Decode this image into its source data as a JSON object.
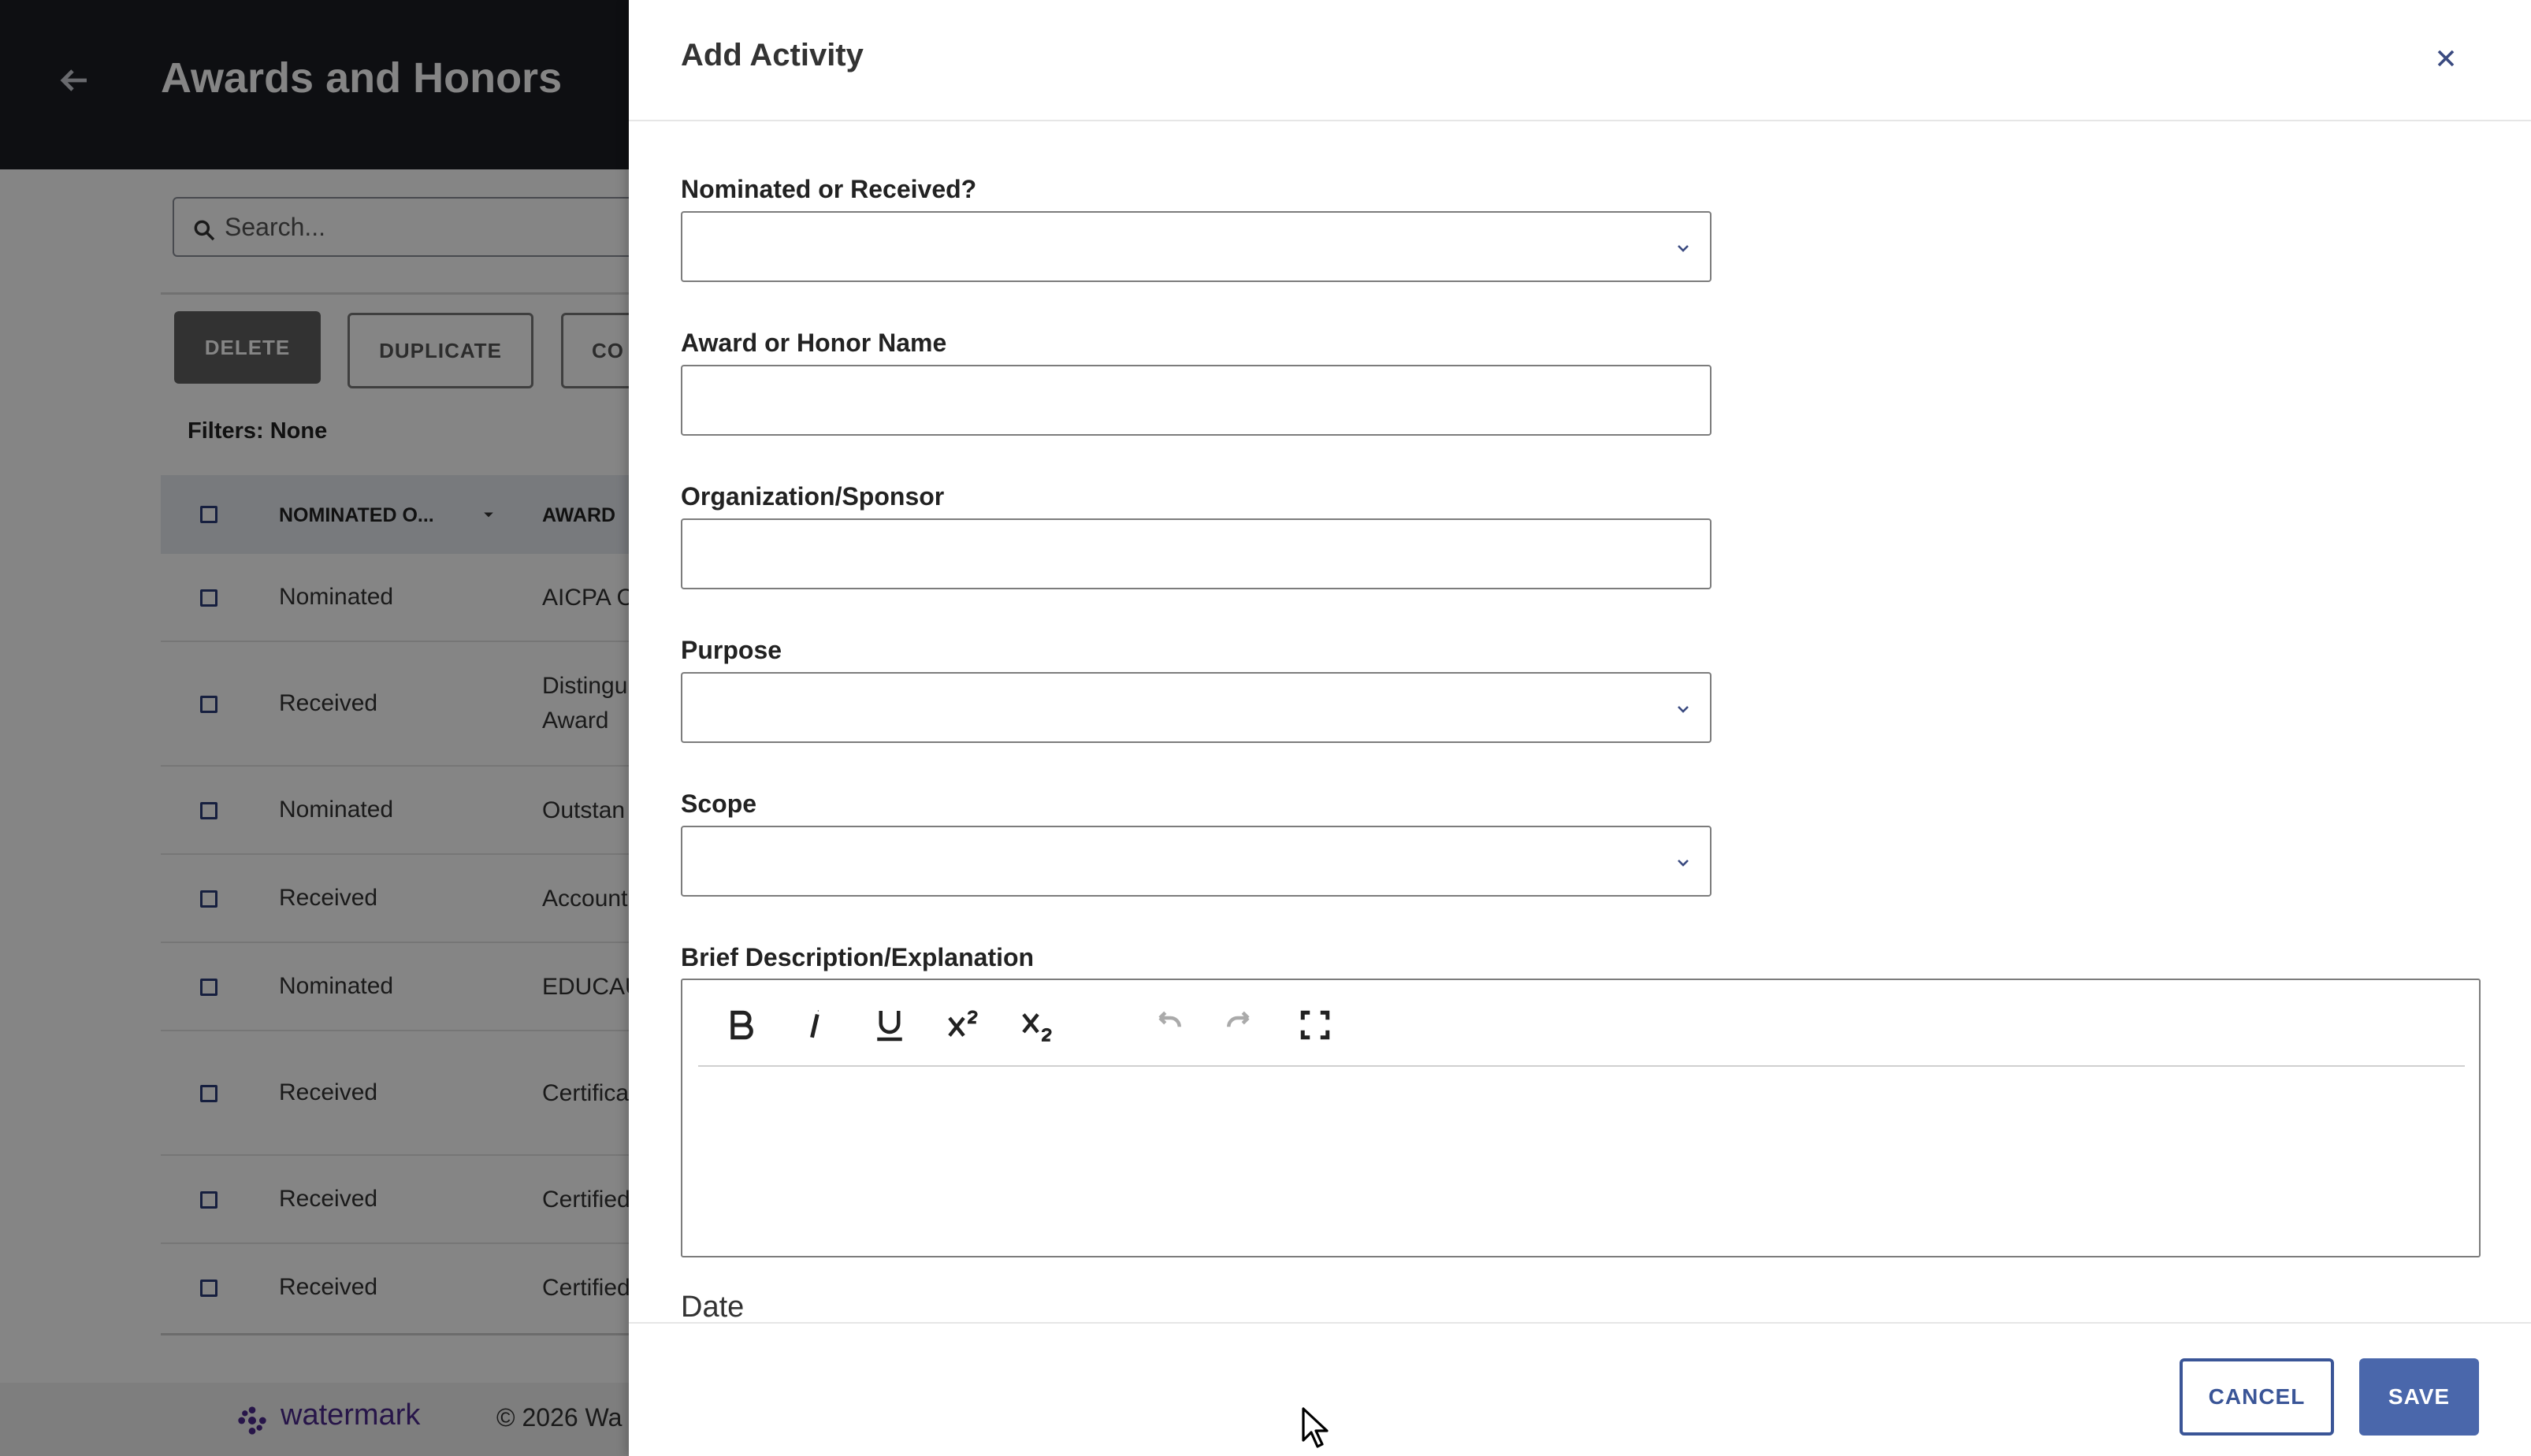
{
  "background": {
    "title": "Awards and Honors",
    "search_placeholder": "Search...",
    "buttons": {
      "delete": "DELETE",
      "duplicate": "DUPLICATE",
      "partial": "CO"
    },
    "filters": "Filters: None",
    "columns": [
      "NOMINATED O...",
      "AWARD"
    ],
    "rows": [
      {
        "status": "Nominated",
        "award": "AICPA C"
      },
      {
        "status": "Received",
        "award": "Distingu Award"
      },
      {
        "status": "Nominated",
        "award": "Outstan"
      },
      {
        "status": "Received",
        "award": "Account"
      },
      {
        "status": "Nominated",
        "award": "EDUCAU"
      },
      {
        "status": "Received",
        "award": "Certifica"
      },
      {
        "status": "Received",
        "award": "Certified"
      },
      {
        "status": "Received",
        "award": "Certified"
      }
    ],
    "footer": {
      "logo": "watermark",
      "copyright": "© 2026 Wa"
    }
  },
  "drawer": {
    "title": "Add Activity",
    "fields": {
      "nominated": {
        "label": "Nominated or Received?",
        "value": ""
      },
      "award_name": {
        "label": "Award or Honor Name",
        "value": ""
      },
      "organization": {
        "label": "Organization/Sponsor",
        "value": ""
      },
      "purpose": {
        "label": "Purpose",
        "value": ""
      },
      "scope": {
        "label": "Scope",
        "value": ""
      },
      "description": {
        "label": "Brief Description/Explanation",
        "value": ""
      },
      "date": {
        "label": "Date"
      }
    },
    "toolbar_icons": [
      "bold-icon",
      "italic-icon",
      "underline-icon",
      "superscript-icon",
      "subscript-icon",
      "undo-icon",
      "redo-icon",
      "fullscreen-icon"
    ],
    "buttons": {
      "cancel": "CANCEL",
      "save": "SAVE"
    }
  },
  "colors": {
    "topbar": "#1b1d23",
    "primary": "#4a67ab",
    "checkbox": "#2b3d7a",
    "brand": "#4b2a8c"
  }
}
